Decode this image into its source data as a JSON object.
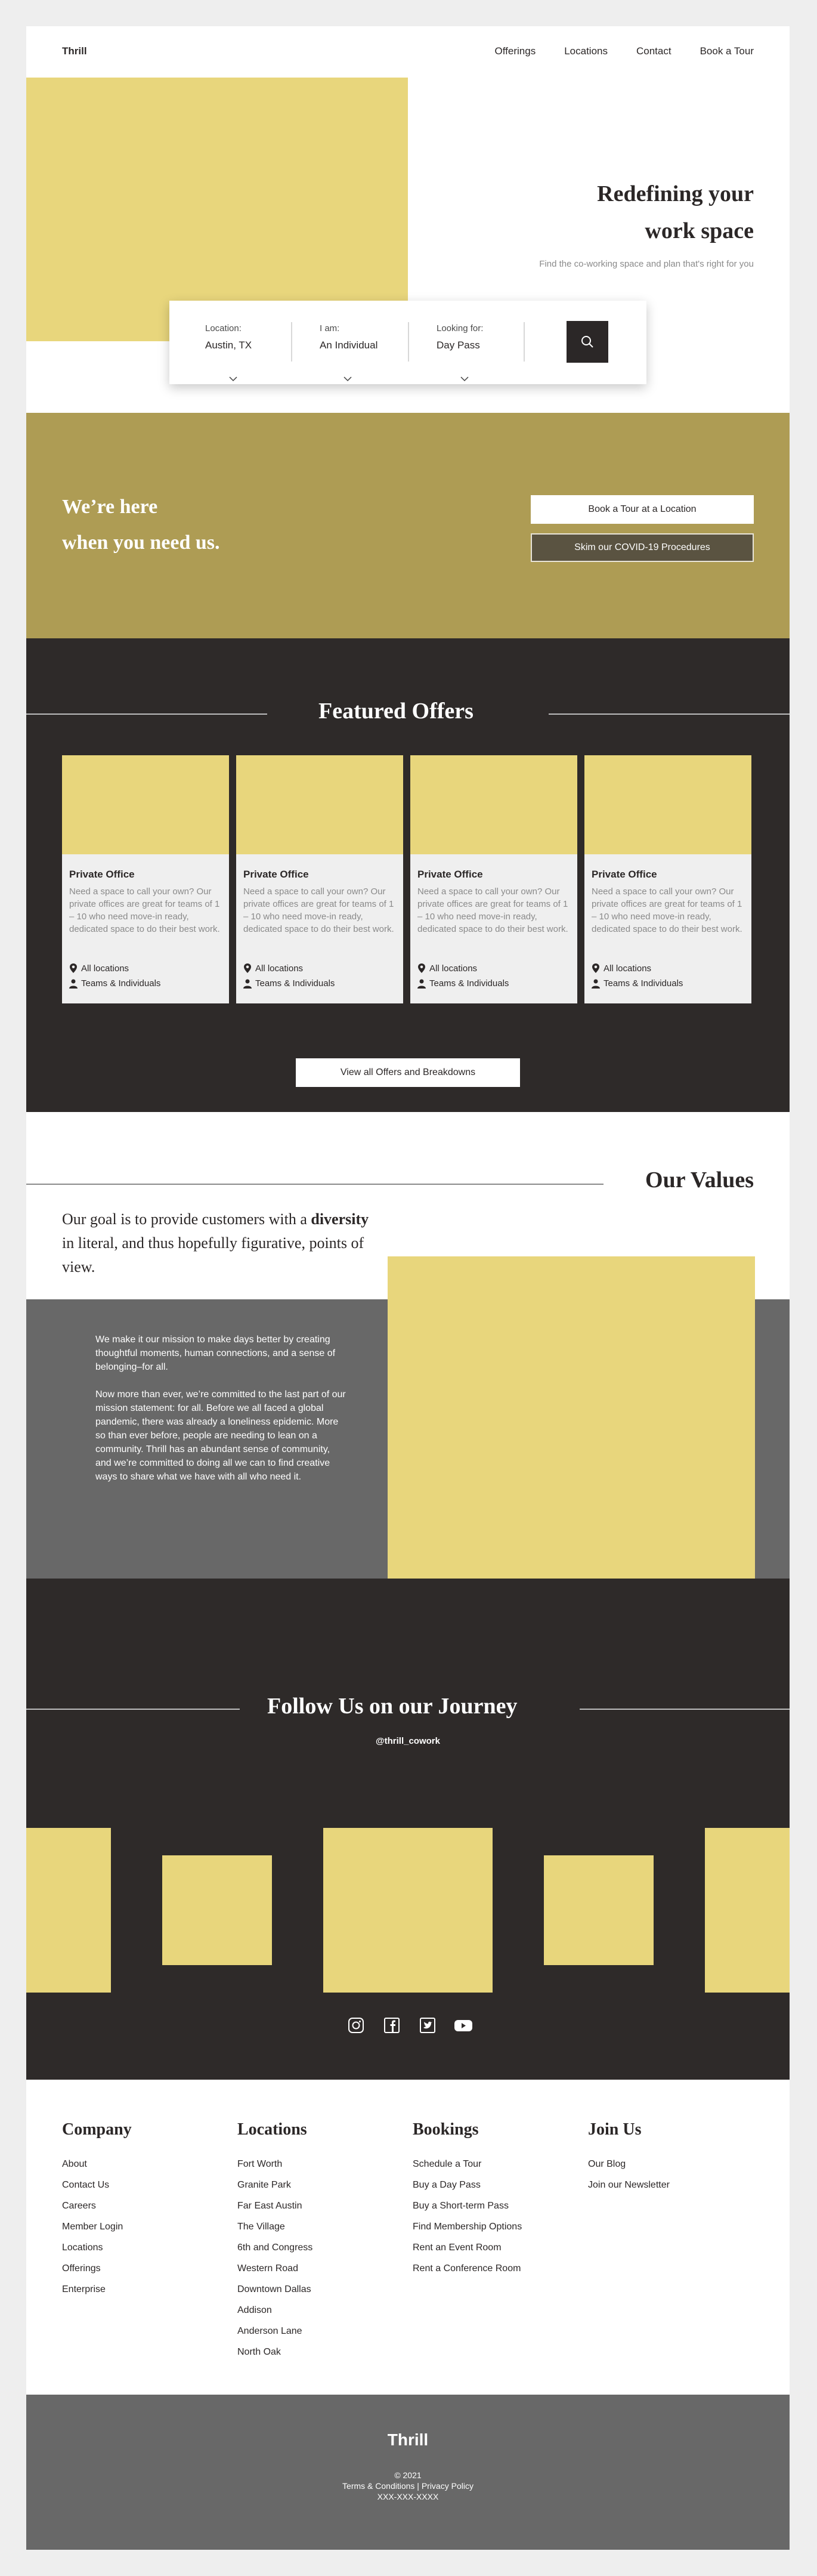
{
  "header": {
    "logo": "Thrill",
    "nav": [
      "Offerings",
      "Locations",
      "Contact",
      "Book a Tour"
    ]
  },
  "hero": {
    "title_line1": "Redefining your",
    "title_line2": "work space",
    "subtitle": "Find the co-working space and plan that's right for you",
    "search": [
      {
        "label": "Location:",
        "value": "Austin, TX"
      },
      {
        "label": "I am:",
        "value": "An Individual"
      },
      {
        "label": "Looking for:",
        "value": "Day Pass"
      }
    ]
  },
  "band": {
    "title_line1": "We’re here",
    "title_line2": "when you need us.",
    "primary_button": "Book a Tour at a Location",
    "secondary_button": "Skim our COVID-19 Procedures"
  },
  "featured": {
    "title": "Featured Offers",
    "offers": [
      {
        "title": "Private Office",
        "description": "Need a space to call your own? Our private offices are great for teams of 1 – 10 who need move-in ready, dedicated space to do their best work.",
        "location": "All locations",
        "audience": "Teams & Individuals"
      },
      {
        "title": "Private Office",
        "description": "Need a space to call your own? Our private offices are great for teams of 1 – 10 who need move-in ready, dedicated space to do their best work.",
        "location": "All locations",
        "audience": "Teams & Individuals"
      },
      {
        "title": "Private Office",
        "description": "Need a space to call your own? Our private offices are great for teams of 1 – 10 who need move-in ready, dedicated space to do their best work.",
        "location": "All locations",
        "audience": "Teams & Individuals"
      },
      {
        "title": "Private Office",
        "description": "Need a space to call your own? Our private offices are great for teams of 1 – 10 who need move-in ready, dedicated space to do their best work.",
        "location": "All locations",
        "audience": "Teams & Individuals"
      }
    ],
    "view_all": "View all Offers and Breakdowns"
  },
  "values": {
    "title": "Our Values",
    "quote_pre": "Our goal is to provide customers with a ",
    "quote_bold": "diversity",
    "quote_post": " in literal, and thus hopefully figurative, points of view.",
    "paragraph1": "We make it our mission to make days better by creating thoughtful moments, human connections, and a sense of belonging–for all.",
    "paragraph2": "Now more than ever, we’re committed to the last part of our mission statement: for all. Before we all faced a global pandemic, there was already a loneliness epidemic. More so than ever before, people are needing to lean on a community. Thrill has an abundant sense of community, and we’re committed to doing all we can to find creative ways to share what we have with all who need it."
  },
  "follow": {
    "title": "Follow Us on our Journey",
    "handle": "@thrill_cowork",
    "social_icons": [
      "instagram-icon",
      "facebook-icon",
      "twitter-icon",
      "youtube-icon"
    ]
  },
  "footer": {
    "columns": [
      {
        "heading": "Company",
        "links": [
          "About",
          "Contact Us",
          "Careers",
          "Member Login",
          "Locations",
          "Offerings",
          "Enterprise"
        ]
      },
      {
        "heading": "Locations",
        "links": [
          "Fort Worth",
          "Granite Park",
          "Far East Austin",
          "The Village",
          "6th and Congress",
          "Western Road",
          "Downtown Dallas",
          "Addison",
          "Anderson Lane",
          "North Oak"
        ]
      },
      {
        "heading": "Bookings",
        "links": [
          "Schedule a Tour",
          "Buy a Day Pass",
          "Buy a Short-term Pass",
          "Find Membership Options",
          "Rent an Event Room",
          "Rent a Conference Room"
        ]
      },
      {
        "heading": "Join Us",
        "links": [
          "Our Blog",
          "Join our Newsletter"
        ]
      }
    ],
    "brand": "Thrill",
    "copyright": "© 2021",
    "legal": "Terms & Conditions | Privacy Policy",
    "phone": "XXX-XXX-XXXX"
  },
  "colors": {
    "accent_yellow": "#e8d67c",
    "olive": "#ae9c54",
    "dark": "#2e2a29",
    "grey": "#686868"
  }
}
